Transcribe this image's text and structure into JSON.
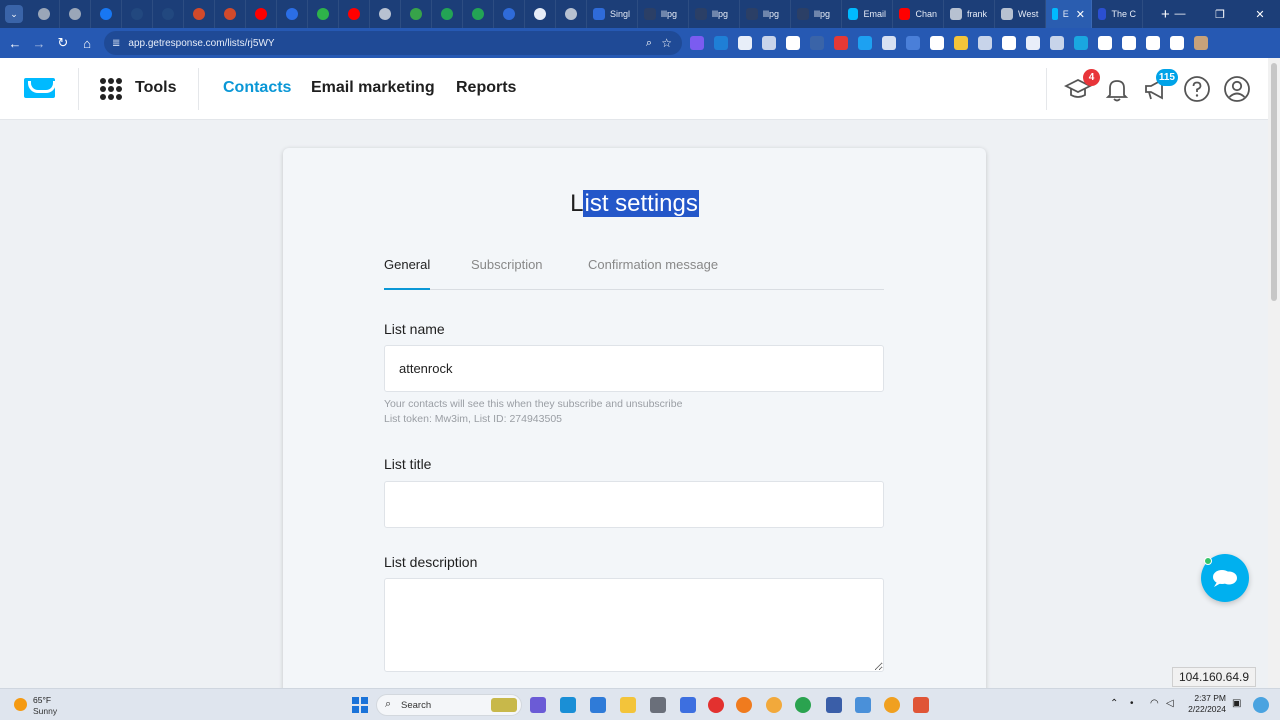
{
  "browser": {
    "tabs": [
      {
        "icon": "chrome-icon",
        "color": "#9aa6b8"
      },
      {
        "icon": "chrome-icon",
        "color": "#9aa6b8"
      },
      {
        "icon": "facebook-icon",
        "color": "#1877f2"
      },
      {
        "icon": "blank-icon",
        "color": "#22487f"
      },
      {
        "icon": "blank-icon",
        "color": "#22487f"
      },
      {
        "icon": "app-icon",
        "color": "#d24a2b"
      },
      {
        "icon": "app-icon",
        "color": "#d24a2b"
      },
      {
        "icon": "youtube-icon",
        "color": "#ff0000"
      },
      {
        "icon": "p-icon",
        "color": "#2b6ee6"
      },
      {
        "icon": "multi-color-icon",
        "color": "#2eb34a"
      },
      {
        "icon": "youtube-icon",
        "color": "#ff0000"
      },
      {
        "icon": "globe-icon",
        "color": "#b7c1d1"
      },
      {
        "icon": "green-box-icon",
        "color": "#37a34a"
      },
      {
        "icon": "dollar-icon",
        "color": "#23a455"
      },
      {
        "icon": "dollar-icon",
        "color": "#23a455"
      },
      {
        "icon": "ai-icon",
        "color": "#2f6bd9"
      },
      {
        "icon": "toggle-icon",
        "color": "#e6ecf7"
      },
      {
        "icon": "globe-icon",
        "color": "#b7c1d1"
      }
    ],
    "titled_tabs": [
      {
        "title": "Singl",
        "color": "#2f6bd9"
      },
      {
        "title": "lllpg",
        "color": "#2b3f66"
      },
      {
        "title": "lllpg",
        "color": "#2b3f66"
      },
      {
        "title": "lllpg",
        "color": "#2b3f66"
      },
      {
        "title": "lllpg",
        "color": "#2b3f66"
      },
      {
        "title": "Email",
        "color": "#00baff"
      },
      {
        "title": "Chan",
        "color": "#ff0000"
      },
      {
        "title": "frank",
        "color": "#b7c1d1"
      },
      {
        "title": "West",
        "color": "#b7c1d1"
      }
    ],
    "active_tab": {
      "title": "E",
      "close": "✕"
    },
    "last_tab": {
      "title": "The C",
      "color": "#2b4fd1"
    },
    "new_tab": "+",
    "url": "app.getresponse.com/lists/rj5WY"
  },
  "header": {
    "tools_label": "Tools",
    "nav": [
      "Contacts",
      "Email marketing",
      "Reports"
    ],
    "learning_badge": "4",
    "announcements_badge": "115"
  },
  "page": {
    "title_plain": "L",
    "title_selected": "ist settings",
    "tabs": [
      "General",
      "Subscription",
      "Confirmation message"
    ],
    "list_name_label": "List name",
    "list_name_value": "attenrock",
    "hint_line1": "Your contacts will see this when they subscribe and unsubscribe",
    "hint_line2": "List token: Mw3im, List ID: 274943505",
    "list_title_label": "List title",
    "list_title_value": "",
    "list_description_label": "List description",
    "list_description_value": ""
  },
  "overlay": {
    "ip_address": "104.160.64.9"
  },
  "taskbar": {
    "temperature": "65°F",
    "weather": "Sunny",
    "search_label": "Search",
    "time": "2:37 PM",
    "date": "2/22/2024"
  }
}
